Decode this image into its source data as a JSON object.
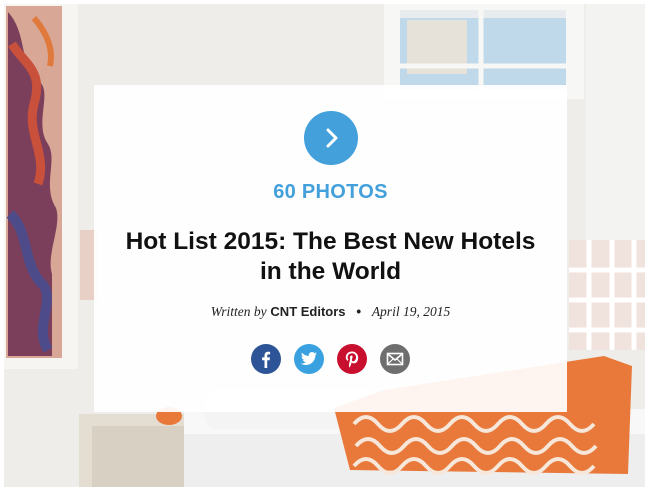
{
  "slideshow": {
    "photo_count_label": "60 PHOTOS",
    "title": "Hot List 2015: The Best New Hotels in the World",
    "byline": {
      "prefix": "Written by",
      "author": "CNT Editors",
      "date": "April 19, 2015"
    },
    "next_icon": "chevron-right-icon",
    "share": [
      {
        "name": "facebook",
        "icon": "facebook-icon",
        "color": "#2d5496"
      },
      {
        "name": "twitter",
        "icon": "twitter-icon",
        "color": "#3aa1e1"
      },
      {
        "name": "pinterest",
        "icon": "pinterest-icon",
        "color": "#c8102e"
      },
      {
        "name": "email",
        "icon": "email-icon",
        "color": "#6e6e6e"
      }
    ]
  },
  "colors": {
    "accent": "#43a0db",
    "pillow_orange": "#e8793a"
  }
}
